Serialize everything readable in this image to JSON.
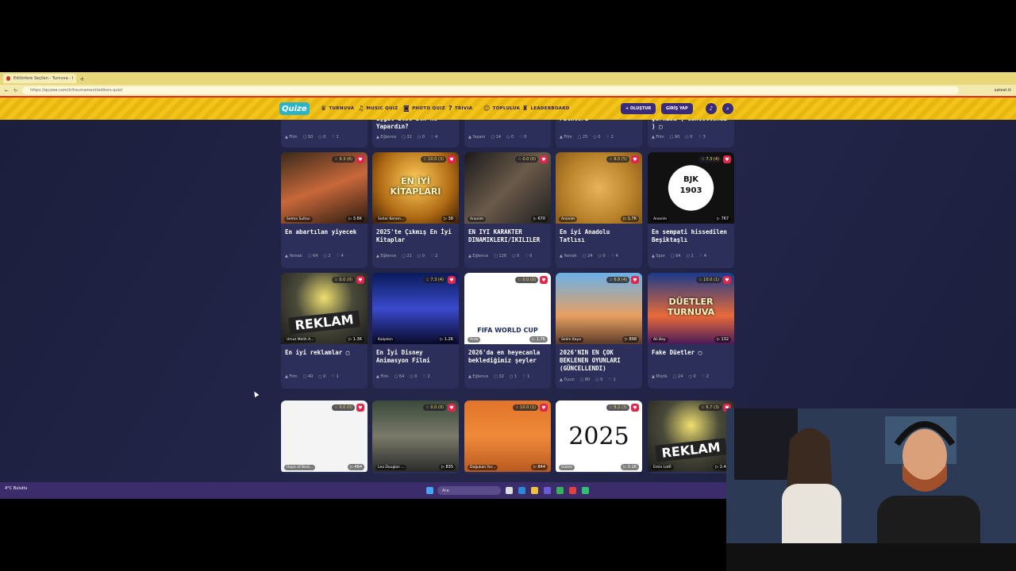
{
  "browser": {
    "tab_title": "Editörlere Seçilen - Turnuva - Quizzo",
    "url": "https://quizee.com/tr/tournament/editors-quiz/",
    "user": "sateat.tt"
  },
  "nav": {
    "logo": "Quize",
    "items": [
      "TURNUVA",
      "MUSIC QUIZ",
      "PHOTO QUIZ",
      "TRIVIA",
      "TOPLULUK",
      "LEADERBOARD"
    ],
    "create_label": "+ OLUŞTUR",
    "login_label": "GİRİŞ YAP"
  },
  "top_row": [
    {
      "title": "",
      "category": "Film",
      "count": "50",
      "c2": "0",
      "likes": "1"
    },
    {
      "title": "İşgal Etse İlk Ne Yapardın?",
      "category": "Eğlence",
      "count": "32",
      "c2": "0",
      "likes": "4"
    },
    {
      "title": "",
      "category": "Yaşam",
      "count": "14",
      "c2": "0",
      "likes": "0"
    },
    {
      "title": "Filmleri",
      "category": "Film",
      "count": "25",
      "c2": "0",
      "likes": "2"
    },
    {
      "title": "Şarkısı ( Güncellendi ) ▢",
      "category": "Film",
      "count": "90",
      "c2": "0",
      "likes": "3"
    }
  ],
  "row1": [
    {
      "title": "En abartılan yiyecek",
      "rating": "9.3 (6)",
      "author": "Selma Sultan",
      "plays": "3.6K",
      "category": "Yemek",
      "count": "64",
      "c2": "2",
      "likes": "4",
      "bg": "sushi"
    },
    {
      "title": "2025'te Çıkmış En İyi Kitaplar",
      "rating": "10.0 (3)",
      "author": "Seher Kerem...",
      "plays": "38",
      "category": "Eğlence",
      "count": "21",
      "c2": "0",
      "likes": "2",
      "bg": "books",
      "overlay": "EN İYİ KİTAPLARI"
    },
    {
      "title": "EN IYI KARAKTER DINAMIKLERI/IKILILER",
      "rating": "0.0 (0)",
      "author": "Anonim",
      "plays": "670",
      "category": "Eğlence",
      "count": "128",
      "c2": "0",
      "likes": "0",
      "bg": "movie"
    },
    {
      "title": "En iyi Anadolu Tatlısı",
      "rating": "8.0 (5)",
      "author": "Anonim",
      "plays": "1.7K",
      "category": "Yemek",
      "count": "24",
      "c2": "0",
      "likes": "4",
      "bg": "dessert"
    },
    {
      "title": "En sempati hissedilen Beşiktaşlı",
      "rating": "7.3 (4)",
      "author": "Anonim",
      "plays": "767",
      "category": "Spor",
      "count": "64",
      "c2": "1",
      "likes": "4",
      "bg": "bjk",
      "overlay": "BJK 1903"
    }
  ],
  "row2": [
    {
      "title": "En iyi reklamlar ▢",
      "rating": "0.0 (0)",
      "author": "Umut Melih A...",
      "plays": "1.3K",
      "category": "Film",
      "count": "40",
      "c2": "0",
      "likes": "1",
      "bg": "reklam",
      "overlay": "REKLAM"
    },
    {
      "title": "En İyi Disney Animasyon Filmi",
      "rating": "7.3 (4)",
      "author": "Kalşelen",
      "plays": "1.2K",
      "category": "Film",
      "count": "64",
      "c2": "0",
      "likes": "2",
      "bg": "disney"
    },
    {
      "title": "2026'da en heyecanla beklediğimiz şeyler",
      "rating": "0.0 (0)",
      "author": "Arda",
      "plays": "1.7K",
      "category": "Eğlence",
      "count": "32",
      "c2": "1",
      "likes": "1",
      "bg": "fifa",
      "overlay": "FIFA WORLD CUP"
    },
    {
      "title": "2026'NIN EN ÇOK BEKLENEN OYUNLARI (GÜNCELLENDI)",
      "rating": "6.8 (4)",
      "author": "Selim Kaya",
      "plays": "898",
      "category": "Oyun",
      "count": "80",
      "c2": "0",
      "likes": "1",
      "bg": "gta"
    },
    {
      "title": "Fake Düetler ▢",
      "rating": "10.0 (1)",
      "author": "Ali Bey",
      "plays": "132",
      "category": "Müzik",
      "count": "24",
      "c2": "0",
      "likes": "2",
      "bg": "duet",
      "overlay": "DÜETLER TURNUVA"
    }
  ],
  "row3": [
    {
      "rating": "0.0 (0)",
      "author": "Hope of Bedi...",
      "plays": "484",
      "bg": "logos"
    },
    {
      "rating": "0.0 (0)",
      "author": "Leo Douglas ...",
      "plays": "835",
      "bg": "f1"
    },
    {
      "rating": "10.0 (1)",
      "author": "Doğukan Yur...",
      "plays": "844",
      "bg": "football"
    },
    {
      "rating": "8.2 (3)",
      "author": "Gizem",
      "plays": "3.1K",
      "bg": "year",
      "overlay": "2025"
    },
    {
      "rating": "6.7 (3)",
      "author": "Emin Lotfi",
      "plays": "2.4K",
      "bg": "reklam",
      "overlay": "REKLAM"
    }
  ],
  "taskbar": {
    "weather": "4°C Bulutlu",
    "search": "Ara"
  },
  "colors": {
    "nav_yellow": "#f2c318",
    "accent_red": "#e2264b",
    "bg": "#1f2040",
    "card": "#2c2f5a"
  }
}
